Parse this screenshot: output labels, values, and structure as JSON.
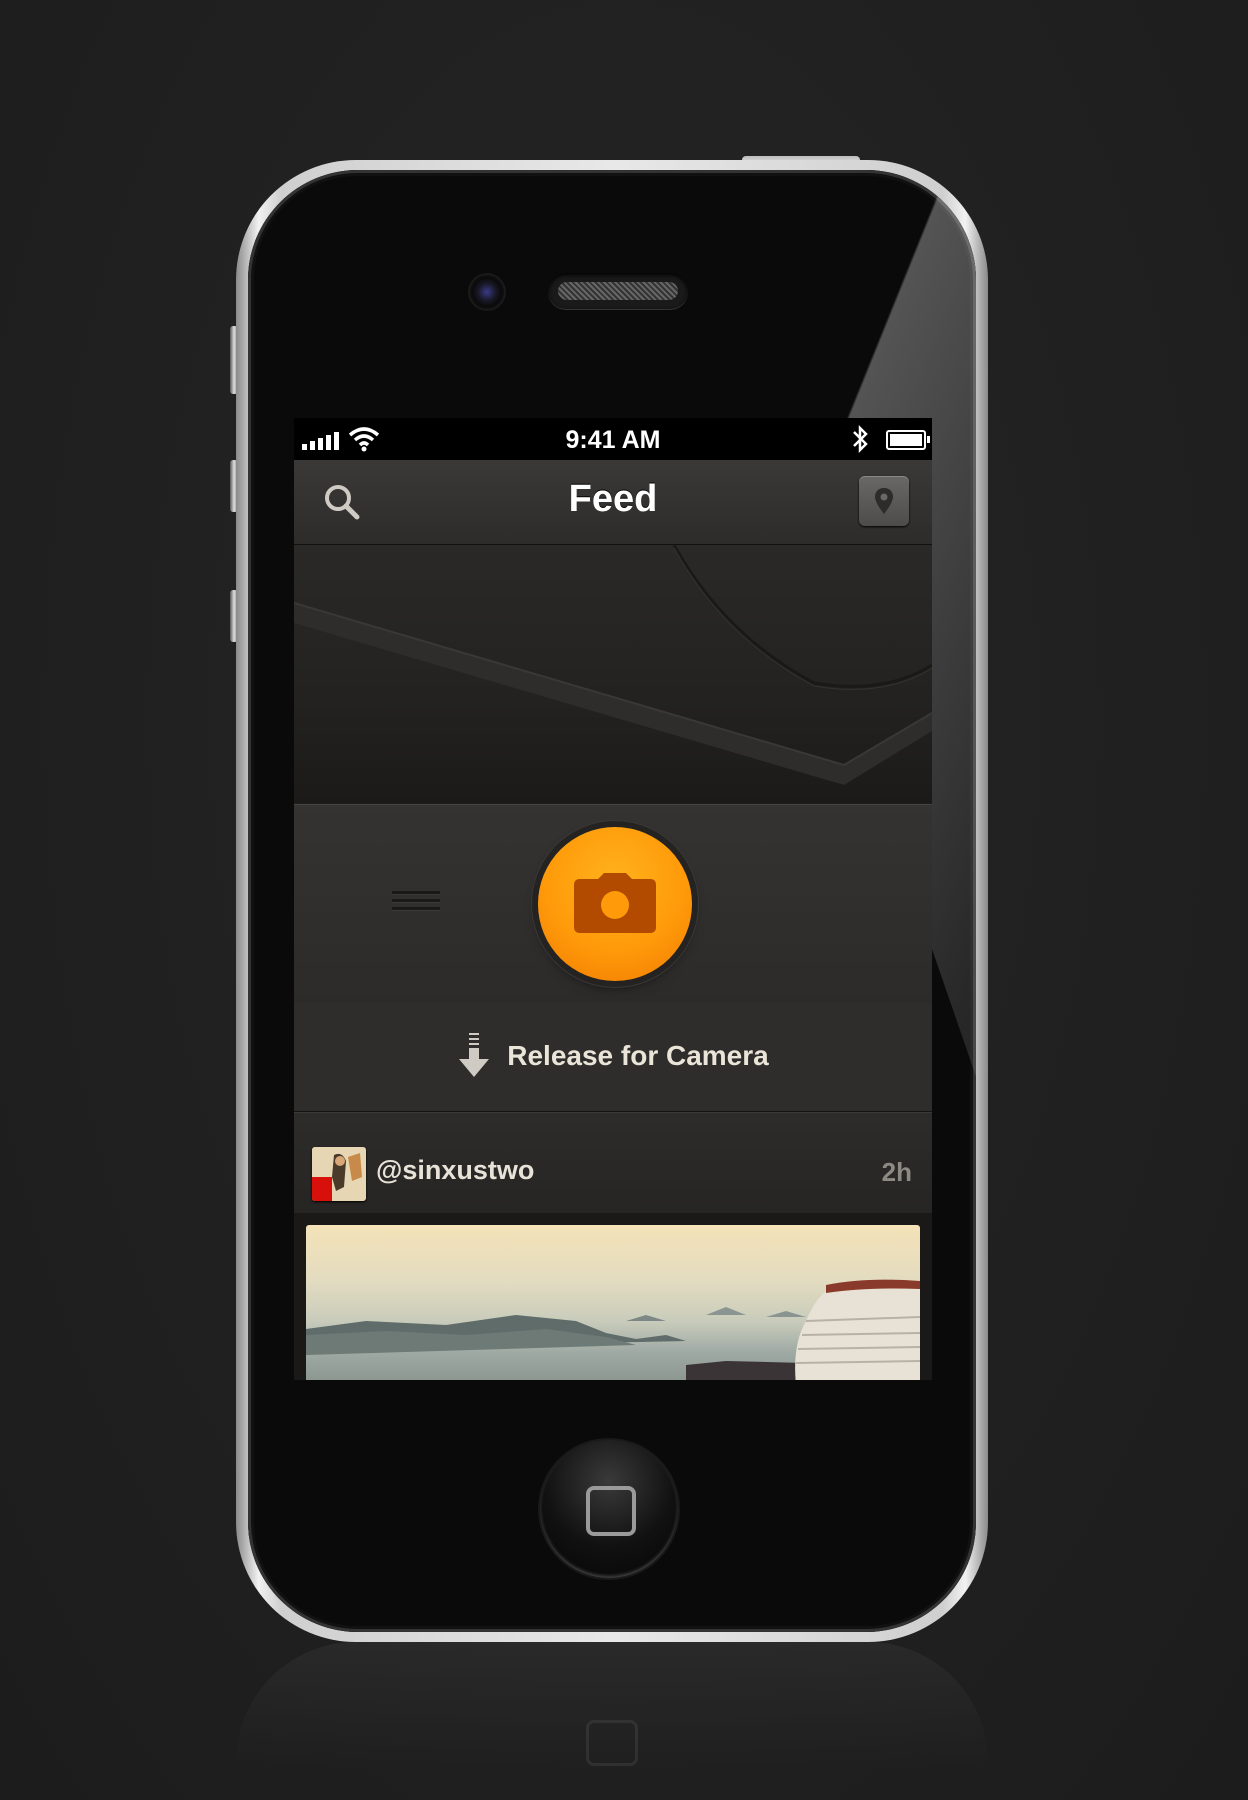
{
  "status_bar": {
    "time": "9:41 AM"
  },
  "nav": {
    "title": "Feed"
  },
  "pull_to_refresh": {
    "label": "Release for Camera"
  },
  "post": {
    "username": "@sinxustwo",
    "time_ago": "2h"
  },
  "colors": {
    "accent": "#ff9a0a",
    "background": "#1d1c1b",
    "nav_bar": "#3b3937"
  },
  "icons": {
    "search": "search-icon",
    "map": "map-pin-icon",
    "camera": "camera-icon",
    "menu": "menu-handle-icon",
    "arrow": "arrow-down-icon"
  }
}
